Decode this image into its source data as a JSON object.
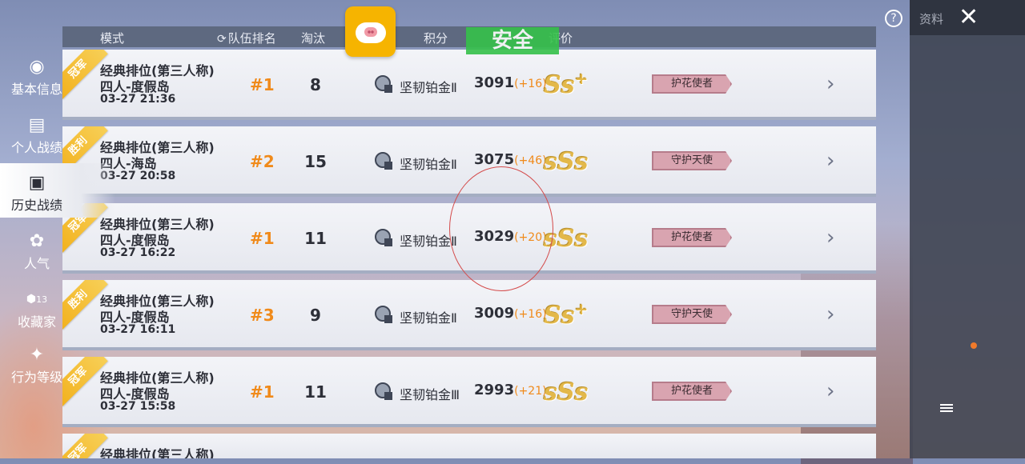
{
  "header": {
    "mode": "模式",
    "team_rank": "队伍排名",
    "eliminations": "淘汰",
    "points": "积分",
    "rating": "评价"
  },
  "overlay": {
    "safe_label": "安全"
  },
  "top_right": {
    "label": "资料"
  },
  "rows": [
    {
      "ribbon": "冠军",
      "mode": "经典排位(第三人称)",
      "map": "四人-度假岛",
      "time": "03-27 21:36",
      "rank": "#1",
      "kills": "8",
      "tier": "坚韧铂金Ⅱ",
      "score": "3091",
      "delta": "(+16)",
      "grade": "Ss",
      "grade_plus": "+",
      "title": "护花使者"
    },
    {
      "ribbon": "胜利",
      "mode": "经典排位(第三人称)",
      "map": "四人-海岛",
      "time": "03-27 20:58",
      "rank": "#2",
      "kills": "15",
      "tier": "坚韧铂金Ⅱ",
      "score": "3075",
      "delta": "(+46)",
      "grade": "sSs",
      "grade_plus": "",
      "title": "守护天使"
    },
    {
      "ribbon": "冠军",
      "mode": "经典排位(第三人称)",
      "map": "四人-度假岛",
      "time": "03-27 16:22",
      "rank": "#1",
      "kills": "11",
      "tier": "坚韧铂金Ⅱ",
      "score": "3029",
      "delta": "(+20)",
      "grade": "sSs",
      "grade_plus": "",
      "title": "护花使者"
    },
    {
      "ribbon": "胜利",
      "mode": "经典排位(第三人称)",
      "map": "四人-度假岛",
      "time": "03-27 16:11",
      "rank": "#3",
      "kills": "9",
      "tier": "坚韧铂金Ⅱ",
      "score": "3009",
      "delta": "(+16)",
      "grade": "Ss",
      "grade_plus": "+",
      "title": "守护天使"
    },
    {
      "ribbon": "冠军",
      "mode": "经典排位(第三人称)",
      "map": "四人-度假岛",
      "time": "03-27 15:58",
      "rank": "#1",
      "kills": "11",
      "tier": "坚韧铂金Ⅲ",
      "score": "2993",
      "delta": "(+21)",
      "grade": "sSs",
      "grade_plus": "",
      "title": "护花使者"
    },
    {
      "ribbon": "冠军",
      "mode": "经典排位(第三人称)"
    }
  ],
  "sidebar": {
    "items": [
      {
        "label": "基本信息",
        "icon": "profile-icon"
      },
      {
        "label": "个人战绩",
        "icon": "stats-icon"
      },
      {
        "label": "历史战绩",
        "icon": "history-icon"
      },
      {
        "label": "人气",
        "icon": "popularity-icon"
      },
      {
        "label": "收藏家",
        "icon": "collector-icon",
        "badge": "13"
      },
      {
        "label": "行为等级",
        "icon": "behavior-icon"
      }
    ]
  },
  "colors": {
    "accent_orange": "#f08a1a",
    "ribbon_gold": "#f2b11e",
    "safe_green": "#35c14a",
    "sidebar_bg": "#3e4452"
  }
}
